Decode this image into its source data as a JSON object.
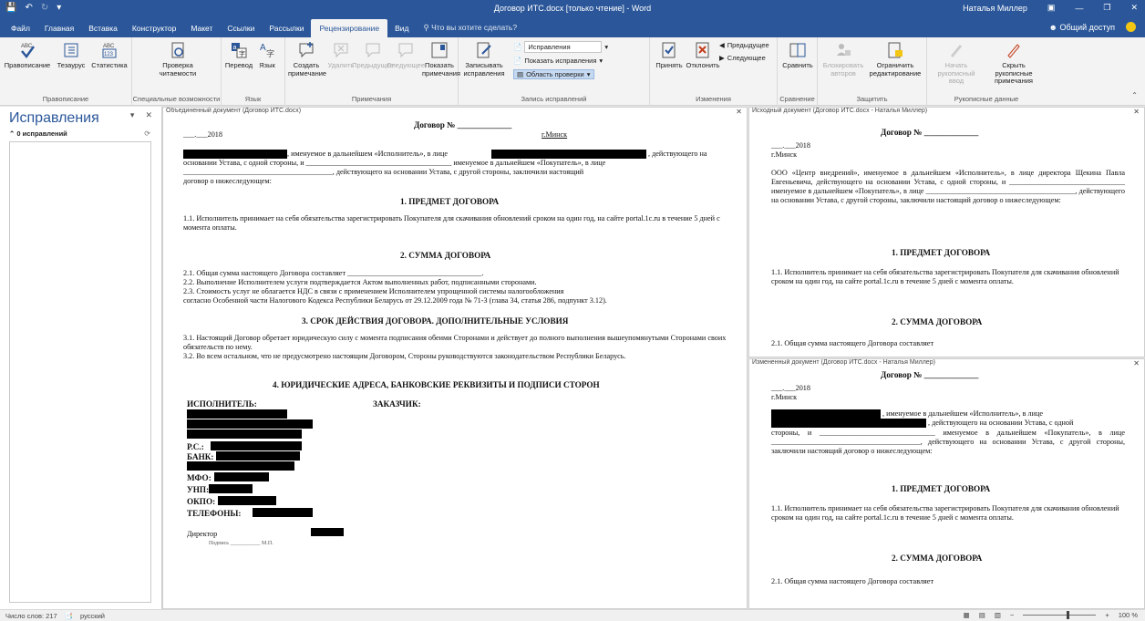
{
  "window": {
    "title": "Договор ИТС.docx [только чтение]  -  Word",
    "user": "Наталья Миллер",
    "qat": [
      "save-icon",
      "undo-icon",
      "redo-icon",
      "customize-icon"
    ],
    "controls": [
      "ribbon-display-icon",
      "minimize-icon",
      "maximize-icon",
      "close-icon"
    ]
  },
  "tabs": [
    "Файл",
    "Главная",
    "Вставка",
    "Конструктор",
    "Макет",
    "Ссылки",
    "Рассылки",
    "Рецензирование",
    "Вид"
  ],
  "active_tab": "Рецензирование",
  "tell_me": "Что вы хотите сделать?",
  "share": "Общий доступ",
  "ribbon": {
    "proofing": {
      "label": "Правописание",
      "spelling": "Правописание",
      "thesaurus": "Тезаурус",
      "stats": "Статистика"
    },
    "accessibility": {
      "label": "Специальные возможности",
      "check": "Проверка читаемости"
    },
    "language": {
      "label": "Язык",
      "translate": "Перевод",
      "language": "Язык"
    },
    "comments": {
      "label": "Примечания",
      "new": "Создать примечание",
      "delete": "Удалить",
      "prev": "Предыдущее",
      "next": "Следующее",
      "show": "Показать примечания"
    },
    "tracking": {
      "label": "Запись исправлений",
      "track": "Записывать исправления",
      "markup_select": "Исправления",
      "show_markup": "Показать исправления",
      "pane": "Область проверки"
    },
    "changes": {
      "label": "Изменения",
      "accept": "Принять",
      "reject": "Отклонить",
      "prev": "Предыдущее",
      "next": "Следующее"
    },
    "compare": {
      "label": "Сравнение",
      "compare": "Сравнить"
    },
    "protect": {
      "label": "Защитить",
      "block": "Блокировать авторов",
      "restrict": "Ограничить редактирование"
    },
    "ink": {
      "label": "Рукописные данные",
      "start": "Начать рукописный ввод",
      "hide": "Скрыть рукописные примечания"
    }
  },
  "revisions_pane": {
    "title": "Исправления",
    "count": "0 исправлений"
  },
  "combined": {
    "title": "Объединенный документ (Договор ИТС.docx)",
    "heading": "Договор № _____________",
    "date": "___.___2018",
    "city": "г.Минск",
    "intro1": ", именуемое в дальнейшем «Исполнитель», в лице",
    "intro2": ", действующего на",
    "intro3": "основании Устава, с одной стороны, и _______________________________________ именуемое в дальнейшем «Покупатель», в лице",
    "intro4": "________________________________________, действующего на основании Устава, с другой стороны, заключили настоящий",
    "intro5": "договор о нижеследующем:",
    "h1": "1. ПРЕДМЕТ ДОГОВОРА",
    "p11": "1.1. Исполнитель принимает на себя обязательства зарегистрировать Покупателя для скачивания обновлений сроком на один год, на сайте portal.1c.ru в течение 5 дней с момента оплаты.",
    "h2": "2. СУММА ДОГОВОРА",
    "p21": "2.1. Общая сумма настоящего Договора составляет ____________________________________.",
    "p22": "2.2. Выполнение Исполнителем услуги подтверждается Актом выполненных работ, подписанными сторонами.",
    "p23": "2.3. Стоимость услуг не облагается НДС в связи с применением Исполнителем упрощенной системы налогообложения",
    "p23b": "согласно Особенной части Налогового Кодекса Республики Беларусь от 29.12.2009 года № 71-З (глава 34, статья 286, подпункт 3.12).",
    "h3": "3. СРОК ДЕЙСТВИЯ ДОГОВОРА. ДОПОЛНИТЕЛЬНЫЕ УСЛОВИЯ",
    "p31": "3.1. Настоящий Договор обретает юридическую силу с момента подписания обеими Сторонами и действует до полного выполнения вышеупомянутыми Сторонами своих обязательств по нему.",
    "p32": "3.2. Во всем остальном, что не предусмотрено настоящим Договором, Стороны руководствуются законодательством Республики Беларусь.",
    "h4": "4. ЮРИДИЧЕСКИЕ АДРЕСА, БАНКОВСКИЕ РЕКВИЗИТЫ И ПОДПИСИ СТОРОН",
    "executor": "ИСПОЛНИТЕЛЬ:",
    "customer": "ЗАКАЗЧИК:",
    "rs": "Р.С.:",
    "bank": "БАНК:",
    "mfo": "МФО:",
    "unp": "УНП:",
    "okpo": "ОКПО:",
    "phones": "ТЕЛЕФОНЫ:",
    "director": "Директор",
    "sign": "Подпись ___________ М.П."
  },
  "original": {
    "title": "Исходный документ (Договор ИТС.docx - Наталья Миллер)",
    "heading": "Договор № _____________",
    "date": "___.___2018",
    "city": "г.Минск",
    "intro": "ООО «Центр внедрений», именуемое в дальнейшем «Исполнитель», в лице директора Щекина Павла Евгеньевича, действующего на основании Устава, с одной стороны, и _______________________________ именуемое в дальнейшем «Покупатель», в лице ________________________________________, действующего на основании Устава, с другой стороны, заключили настоящий договор о нижеследующем:",
    "h1": "1. ПРЕДМЕТ ДОГОВОРА",
    "p11": "1.1. Исполнитель принимает на себя обязательства зарегистрировать Покупателя для скачивания обновлений сроком на один год, на сайте portal.1c.ru в течение 5 дней с момента оплаты.",
    "h2": "2. СУММА ДОГОВОРА",
    "p21": "2.1.       Общая       сумма       настоящего       Договора       составляет"
  },
  "revised": {
    "title": "Измененный документ (Договор ИТС.docx - Наталья Миллер)",
    "heading": "Договор № _____________",
    "date": "___.___2018",
    "city": "г.Минск",
    "intro1": ", именуемое в дальнейшем «Исполнитель», в лице",
    "intro2": ", действующего на основании Устава, с одной",
    "intro3": "стороны, и _______________________________ именуемое в дальнейшем «Покупатель», в лице ________________________________________, действующего на основании Устава, с другой стороны, заключили настоящий договор о нижеследующем:",
    "h1": "1. ПРЕДМЕТ ДОГОВОРА",
    "p11": "1.1. Исполнитель принимает на себя обязательства зарегистрировать Покупателя для скачивания обновлений сроком на один год, на сайте portal.1c.ru в течение 5 дней с момента оплаты.",
    "h2": "2. СУММА ДОГОВОРА",
    "p21": "2.1.       Общая       сумма       настоящего       Договора       составляет"
  },
  "status": {
    "words": "Число слов: 217",
    "language": "русский",
    "zoom": "100 %"
  },
  "colors": {
    "brand": "#2b579a",
    "ribbon": "#f3f3f3"
  }
}
